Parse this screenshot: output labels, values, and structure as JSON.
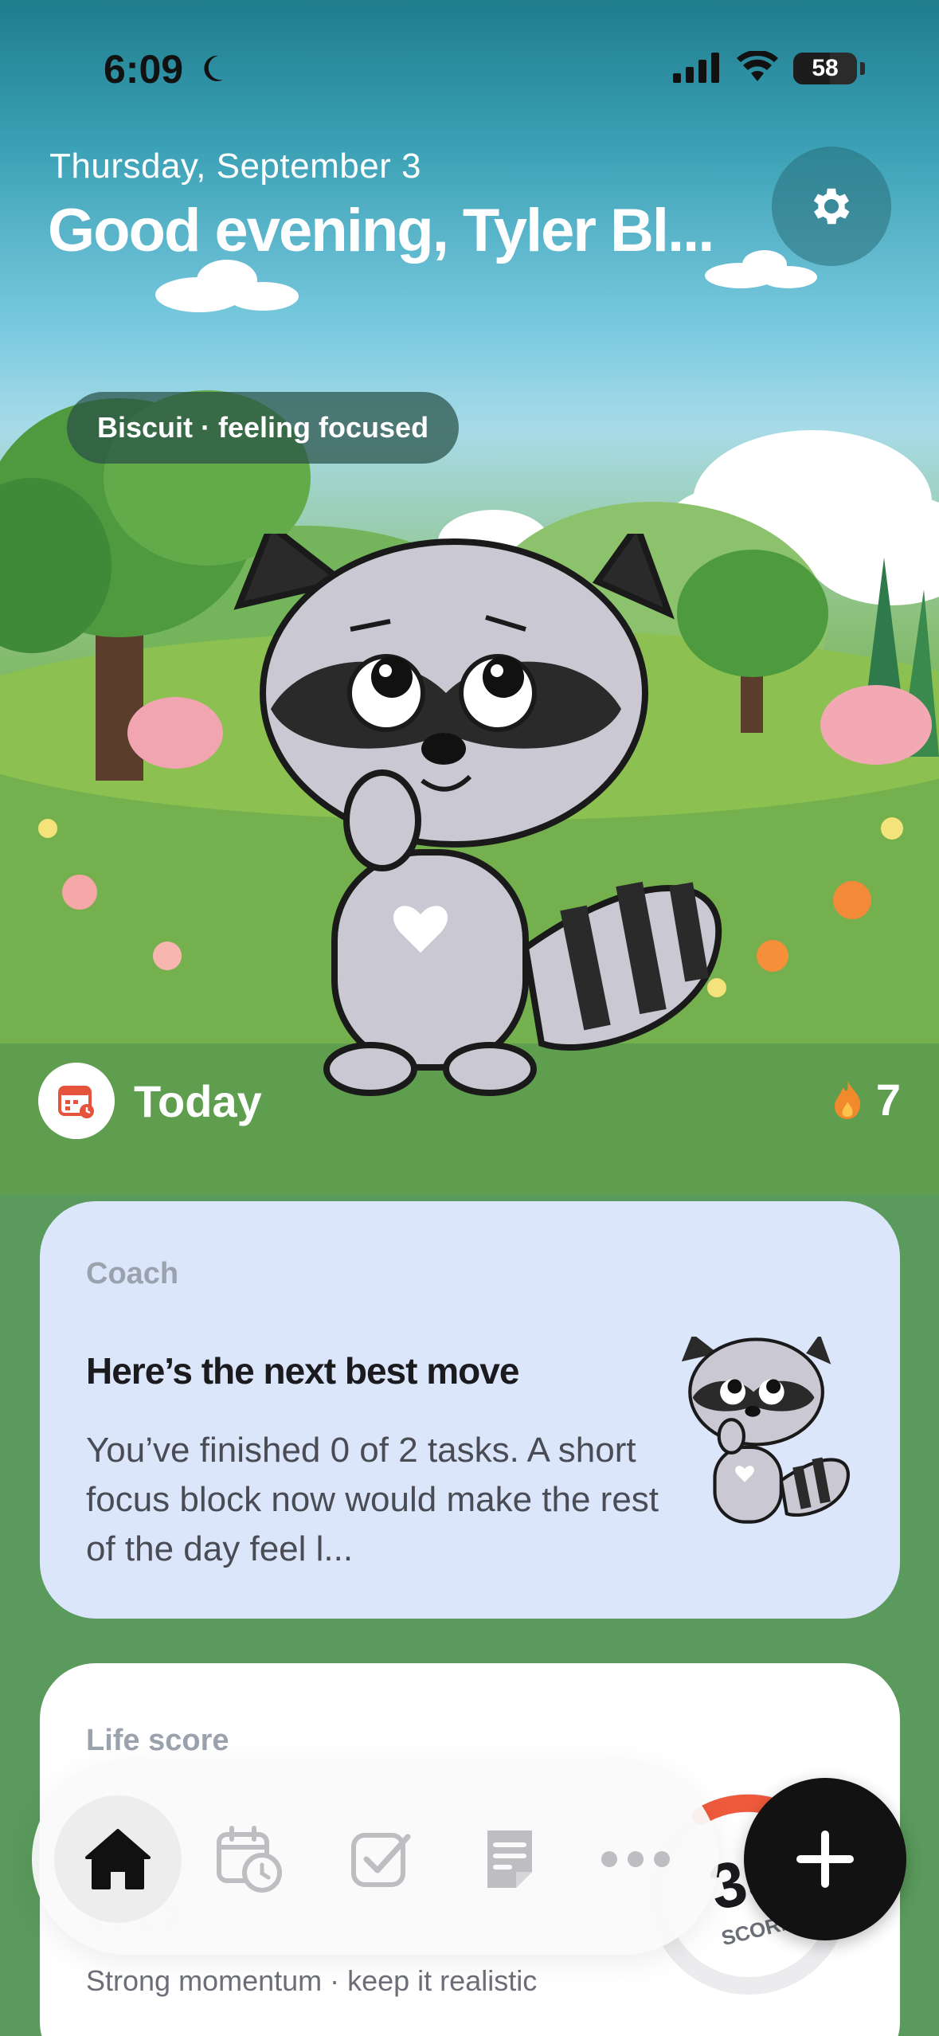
{
  "status_bar": {
    "time": "6:09",
    "battery": "58",
    "icons": [
      "moon-icon",
      "signal-icon",
      "wifi-icon",
      "battery-icon"
    ]
  },
  "header": {
    "date": "Thursday, September 3",
    "greeting": "Good evening, Tyler Bl...",
    "settings_icon": "gear-icon"
  },
  "pet": {
    "mood": "Biscuit · feeling focused"
  },
  "today": {
    "label": "Today",
    "streak": "7",
    "icon": "calendar-icon",
    "streak_icon": "flame-icon"
  },
  "coach": {
    "label": "Coach",
    "title": "Here’s the next best move",
    "body": "You’ve finished 0 of 2 tasks. A short focus block now would make the rest of the day feel l..."
  },
  "life_score": {
    "label": "Life score",
    "value": "35",
    "ring_label": "SCORE",
    "subtitle": "Strong momentum · keep it realistic"
  },
  "tabbar": {
    "items": [
      "home-icon",
      "calendar-clock-icon",
      "checkbox-icon",
      "notes-icon",
      "more-icon"
    ],
    "add_icon": "plus-icon"
  },
  "colors": {
    "coach_card": "#dce6fb",
    "streak_flame": "#f08a2a",
    "ring_accent": "#f05a3c",
    "fab": "#121212"
  }
}
